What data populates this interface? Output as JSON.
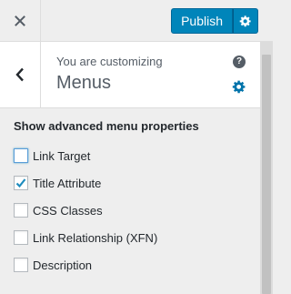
{
  "header": {
    "close_icon": "close-icon",
    "publish_label": "Publish",
    "publish_settings_icon": "gear-icon",
    "accent_color": "#0085ba"
  },
  "panel": {
    "back_icon": "chevron-left-icon",
    "customizing_label": "You are customizing",
    "title": "Menus",
    "help_icon": "help-icon",
    "help_glyph": "?",
    "settings_icon": "gear-icon"
  },
  "options": {
    "heading": "Show advanced menu properties",
    "items": [
      {
        "label": "Link Target",
        "checked": false
      },
      {
        "label": "Title Attribute",
        "checked": true
      },
      {
        "label": "CSS Classes",
        "checked": false
      },
      {
        "label": "Link Relationship (XFN)",
        "checked": false
      },
      {
        "label": "Description",
        "checked": false
      }
    ]
  }
}
